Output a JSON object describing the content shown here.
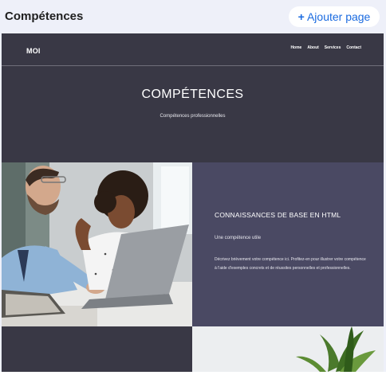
{
  "header": {
    "title": "Compétences",
    "add_page_label": "Ajouter page",
    "add_page_icon": "+"
  },
  "site": {
    "logo": "MOI",
    "nav": [
      "Home",
      "About",
      "Services",
      "Contact"
    ],
    "hero_title": "COMPÉTENCES",
    "hero_subtitle": "Compétences professionnelles",
    "skill": {
      "title": "CONNAISSANCES DE BASE EN HTML",
      "subtitle": "Une compétence utile",
      "description": "Décrivez brièvement votre compétence ici. Profitez-en pour illustrer votre compétence à l'aide d'exemples concrets et de réussites personnelles et professionnelles."
    }
  },
  "colors": {
    "app_bg": "#eef0f9",
    "accent": "#1b6be0",
    "site_dark": "#393845",
    "card_bg": "#4a4963"
  }
}
